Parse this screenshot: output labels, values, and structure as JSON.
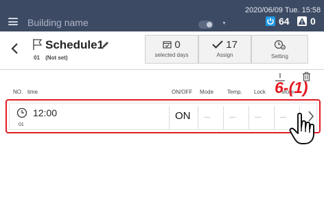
{
  "topbar": {
    "building_name": "Building name",
    "datetime": "2020/06/09 Tue. 15:58",
    "power_count": "64",
    "warning_count": "0",
    "power_color": "#1e9be8"
  },
  "header": {
    "schedule_name": "Schedule1",
    "schedule_no": "01",
    "schedule_status": "(Not set)",
    "selected_days_count": "0",
    "selected_days_label": "selected days",
    "assign_count": "17",
    "assign_label": "Assign",
    "setting_label": "Setting"
  },
  "columns": {
    "no": "NO.",
    "time": "time",
    "onoff": "ON/OFF",
    "mode": "Mode",
    "temp": "Temp.",
    "lock": "Lock",
    "more": "More"
  },
  "annotation": {
    "label": "6-(1)",
    "color": "#e21b23"
  },
  "rows": [
    {
      "no": "01",
      "time": "12:00",
      "onoff": "ON",
      "mode": "---",
      "temp": "---",
      "lock": "---",
      "more": "---"
    }
  ],
  "icons": [
    "menu-icon",
    "toggle-icon",
    "power-icon",
    "warning-icon",
    "back-icon",
    "flag-icon",
    "pencil-icon",
    "calendar-icon",
    "check-icon",
    "clock-settings-icon",
    "add-icon",
    "trash-icon",
    "clock-icon",
    "chevron-right-icon",
    "pointer-hand-icon"
  ]
}
